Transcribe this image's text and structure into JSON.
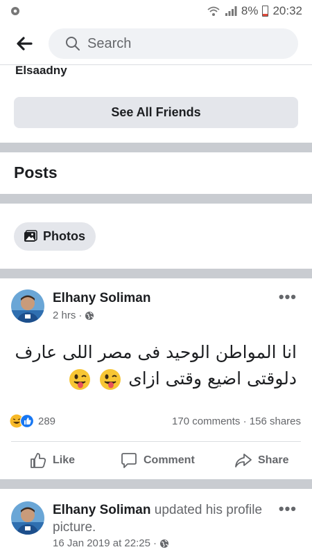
{
  "status_bar": {
    "battery": "8%",
    "time": "20:32",
    "icons": [
      "settings-gear-icon",
      "wifi-icon",
      "signal-icon",
      "battery-icon"
    ]
  },
  "top_bar": {
    "back_icon": "back-arrow-icon",
    "search_placeholder": "Search"
  },
  "friends": {
    "partial_name": "Elsaadny",
    "see_all_label": "See All Friends"
  },
  "posts_section": {
    "title": "Posts",
    "photos_chip_label": "Photos"
  },
  "posts": [
    {
      "author": "Elhany Soliman",
      "time": "2 hrs",
      "privacy_icon": "globe-icon",
      "text_line1": "انا المواطن الوحيد فى مصر اللى عارف",
      "text_line2": "دلوقتى اضيع وقتى ازاى",
      "emojis": [
        "winking-tongue-emoji",
        "winking-tongue-emoji"
      ],
      "reactions": [
        "haha-react",
        "like-react"
      ],
      "reaction_count": "289",
      "comments": "170 comments",
      "shares": "156 shares",
      "actions": {
        "like": "Like",
        "comment": "Comment",
        "share": "Share"
      }
    },
    {
      "author": "Elhany Soliman",
      "action_text": " updated his profile picture.",
      "time": "16 Jan 2019 at 22:25",
      "privacy_icon": "globe-icon"
    }
  ],
  "colors": {
    "separator": "#c9ccd1",
    "chip_bg": "#e4e6eb",
    "search_bg": "#f0f2f5",
    "secondary_text": "#65676b",
    "like_blue": "#1877f2"
  }
}
